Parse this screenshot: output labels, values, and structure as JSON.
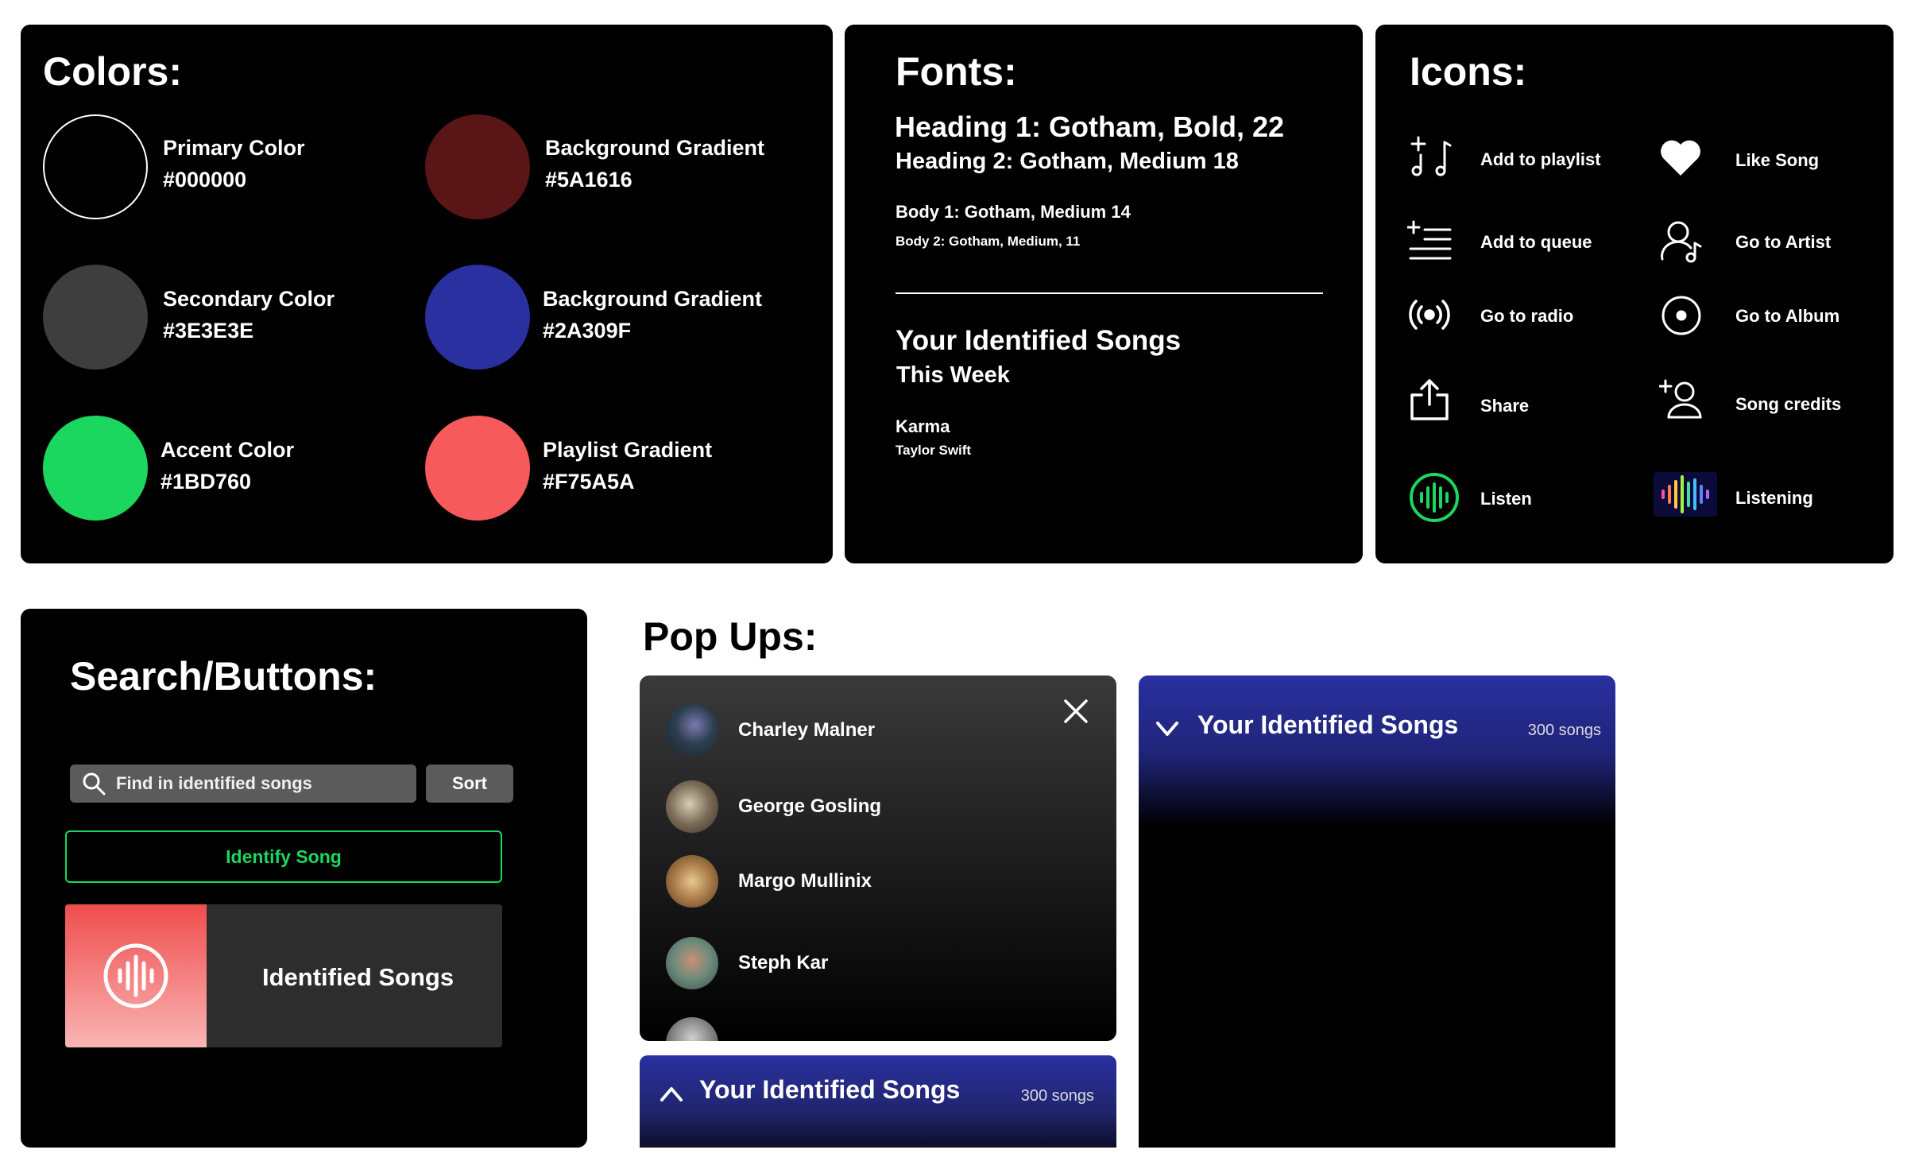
{
  "colors": {
    "title": "Colors:",
    "swatches": [
      {
        "name": "Primary Color",
        "hex": "#000000"
      },
      {
        "name": "Secondary Color",
        "hex": "#3E3E3E"
      },
      {
        "name": "Accent Color",
        "hex": "#1BD760"
      },
      {
        "name": "Background Gradient",
        "hex": "#5A1616"
      },
      {
        "name": "Background Gradient",
        "hex": "#2A309F"
      },
      {
        "name": "Playlist Gradient",
        "hex": "#F75A5A"
      }
    ]
  },
  "fonts": {
    "title": "Fonts:",
    "heading1": "Heading 1: Gotham, Bold, 22",
    "heading2": "Heading 2: Gotham, Medium 18",
    "body1": "Body 1: Gotham, Medium 14",
    "body2": "Body 2: Gotham, Medium, 11",
    "sample_heading": "Your Identified Songs",
    "sample_subheading": "This Week",
    "sample_song": "Karma",
    "sample_artist": "Taylor Swift"
  },
  "icons": {
    "title": "Icons:",
    "items": [
      {
        "label": "Add to playlist",
        "icon": "add-to-playlist-icon"
      },
      {
        "label": "Add to queue",
        "icon": "add-to-queue-icon"
      },
      {
        "label": "Go to radio",
        "icon": "radio-icon"
      },
      {
        "label": "Share",
        "icon": "share-icon"
      },
      {
        "label": "Listen",
        "icon": "listen-icon"
      },
      {
        "label": "Like Song",
        "icon": "heart-icon"
      },
      {
        "label": "Go to Artist",
        "icon": "artist-icon"
      },
      {
        "label": "Go to Album",
        "icon": "album-icon"
      },
      {
        "label": "Song credits",
        "icon": "song-credits-icon"
      },
      {
        "label": "Listening",
        "icon": "listening-icon"
      }
    ]
  },
  "search": {
    "title": "Search/Buttons:",
    "placeholder": "Find in identified songs",
    "sort_label": "Sort",
    "identify_label": "Identify Song",
    "identified_label": "Identified Songs"
  },
  "popups": {
    "title": "Pop Ups:",
    "people": [
      "Charley Malner",
      "George Gosling",
      "Margo Mullinix",
      "Steph Kar"
    ],
    "bar_title": "Your Identified Songs",
    "song_count": "300 songs"
  },
  "accent": "#1BD760"
}
